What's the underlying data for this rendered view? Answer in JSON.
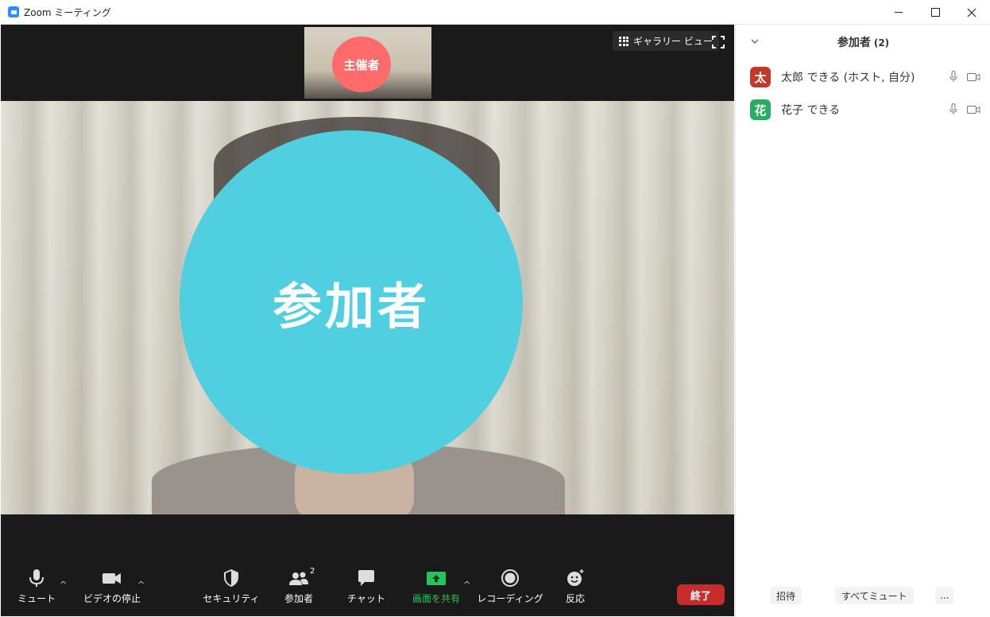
{
  "window": {
    "title": "Zoom ミーティング",
    "controls": [
      "minimize",
      "maximize",
      "close"
    ]
  },
  "video": {
    "thumbnail_label": "主催者",
    "main_label": "参加者",
    "gallery_view_label": "ギャラリー ビュー"
  },
  "toolbar": {
    "mute": "ミュート",
    "stop_video": "ビデオの停止",
    "security": "セキュリティ",
    "participants": "参加者",
    "participants_count": "2",
    "chat": "チャット",
    "share_screen": "画面を共有",
    "recording": "レコーディング",
    "reactions": "反応",
    "end": "終了",
    "share_color": "#22c55e",
    "end_color": "#c62c2c"
  },
  "sidebar": {
    "title": "参加者",
    "count": "(2)",
    "participants": [
      {
        "avatar": "太",
        "name": "太郎 できる (ホスト, 自分)",
        "color": "#c0392b"
      },
      {
        "avatar": "花",
        "name": "花子 できる",
        "color": "#27ae60"
      }
    ],
    "footer": {
      "invite": "招待",
      "mute_all": "すべてミュート",
      "more": "..."
    }
  }
}
